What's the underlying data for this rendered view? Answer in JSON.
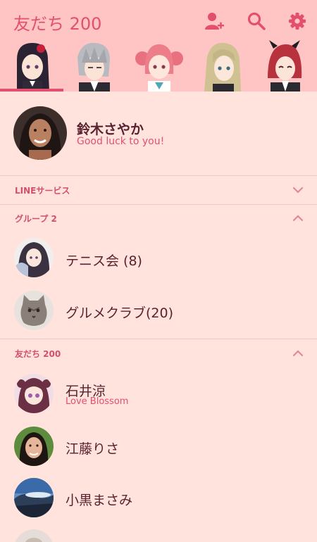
{
  "header": {
    "title": "友だち 200",
    "icons": [
      "add-friend-icon",
      "search-icon",
      "gear-icon"
    ],
    "accent": "#e2506e",
    "background": "#ffc4c4"
  },
  "profile": {
    "name": "鈴木さやか",
    "status": "Good luck to you!"
  },
  "sections": {
    "line_services": "LINEサービス",
    "group": "グループ 2",
    "friends": "友だち 200"
  },
  "groups": [
    {
      "name": "テニス会 (8)"
    },
    {
      "name": "グルメクラブ(20)"
    }
  ],
  "friends": [
    {
      "name": "石井涼",
      "status": "Love Blossom"
    },
    {
      "name": "江藤りさ"
    },
    {
      "name": "小黒まさみ"
    }
  ],
  "colors": {
    "page_bg": "#ffe3dc",
    "text": "#5a2230",
    "divider": "#f2c7c4"
  }
}
